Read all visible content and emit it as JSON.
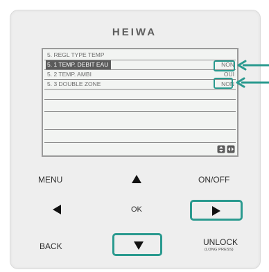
{
  "brand": "HEIWA",
  "lcd": {
    "header": "5. REGL TYPE TEMP",
    "rows": [
      {
        "label": "5. 1 TEMP. DEBIT EAU",
        "value": "NON",
        "selected": true
      },
      {
        "label": "5. 2 TEMP. AMBI",
        "value": "OUI",
        "selected": false
      },
      {
        "label": "5. 3 DOUBLE ZONE",
        "value": "NON",
        "selected": false
      }
    ],
    "icons": [
      "up-down-icon",
      "left-right-icon"
    ]
  },
  "keys": {
    "menu": "MENU",
    "on_off": "ON/OFF",
    "ok": "OK",
    "back": "BACK",
    "unlock": "UNLOCK",
    "unlock_sub": "(LONG PRESS)"
  },
  "accent_color": "#2a9a8f",
  "highlighted": [
    "row-value-non",
    "row-value-oui",
    "right-button",
    "down-button"
  ]
}
